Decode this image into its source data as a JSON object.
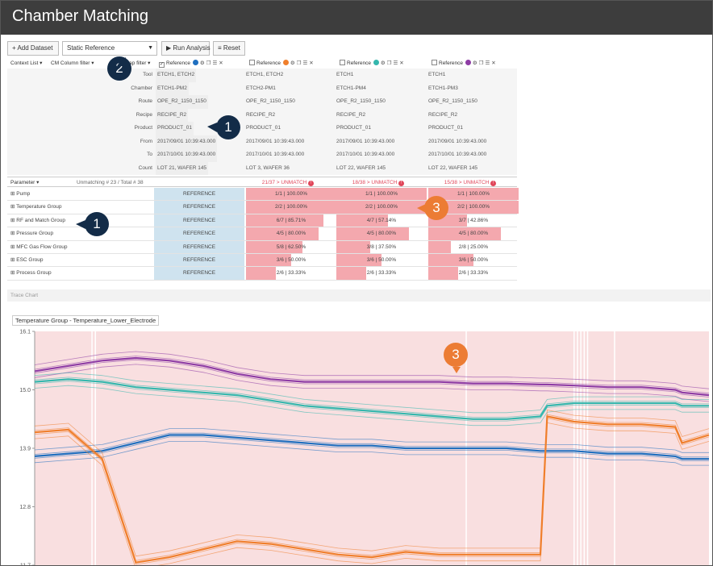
{
  "title": "Chamber Matching",
  "toolbar": {
    "add_dataset": "+ Add Dataset",
    "reference_select": "Static Reference",
    "run_analysis": "▶ Run Analysis",
    "reset": "Reset"
  },
  "header": {
    "context_list": "Context List ▾",
    "cm_column_filter": "CM Column filter ▾",
    "gap_filter": "Gap filter ▾",
    "columns": [
      {
        "label": "Reference",
        "checked": true,
        "color": "#1f6fbf"
      },
      {
        "label": "Reference",
        "checked": false,
        "color": "#f07f2c"
      },
      {
        "label": "Reference",
        "checked": false,
        "color": "#34b7ad"
      },
      {
        "label": "Reference",
        "checked": false,
        "color": "#8e3ca5"
      }
    ]
  },
  "meta": {
    "labels": [
      "Tool",
      "Chamber",
      "Route",
      "Recipe",
      "Product",
      "From",
      "To",
      "Count"
    ],
    "columns": [
      [
        "ETCH1, ETCH2",
        "ETCH1-PM2",
        "OPE_R2_1150_1150",
        "RECIPE_R2",
        "PRODUCT_01",
        "2017/09/01 10:39:43.000",
        "2017/10/01 10:39:43.000",
        "LOT 21, WAFER 145"
      ],
      [
        "ETCH1, ETCH2",
        "ETCH2-PM1",
        "OPE_R2_1150_1150",
        "RECIPE_R2",
        "PRODUCT_01",
        "2017/09/01 10:39:43.000",
        "2017/10/01 10:39:43.000",
        "LOT 3, WAFER 36"
      ],
      [
        "ETCH1",
        "ETCH1-PM4",
        "OPE_R2_1150_1150",
        "RECIPE_R2",
        "PRODUCT_01",
        "2017/09/01 10:39:43.000",
        "2017/10/01 10:39:43.000",
        "LOT 22, WAFER 145"
      ],
      [
        "ETCH1",
        "ETCH1-PM3",
        "OPE_R2_1150_1150",
        "RECIPE_R2",
        "PRODUCT_01",
        "2017/09/01 10:39:43.000",
        "2017/10/01 10:39:43.000",
        "LOT 22, WAFER 145"
      ]
    ]
  },
  "params": {
    "header_label": "Parameter ▾",
    "summary": "Unmatching # 23 / Total # 38",
    "unmatch": [
      "21/37 > UNMATCH",
      "18/38 > UNMATCH",
      "15/38 > UNMATCH"
    ],
    "rows": [
      {
        "name": "Pump",
        "ref": "REFERENCE",
        "cells": [
          {
            "text": "1/1 | 100.00%",
            "pct": 100
          },
          {
            "text": "1/1 | 100.00%",
            "pct": 100
          },
          {
            "text": "1/1 | 100.00%",
            "pct": 100
          }
        ]
      },
      {
        "name": "Temperature Group",
        "ref": "REFERENCE",
        "cells": [
          {
            "text": "2/2 | 100.00%",
            "pct": 100
          },
          {
            "text": "2/2 | 100.00%",
            "pct": 100
          },
          {
            "text": "2/2 | 100.00%",
            "pct": 100
          }
        ]
      },
      {
        "name": "RF and Match Group",
        "ref": "REFERENCE",
        "cells": [
          {
            "text": "6/7 | 85.71%",
            "pct": 85.71
          },
          {
            "text": "4/7 | 57.14%",
            "pct": 57.14
          },
          {
            "text": "3/7 | 42.86%",
            "pct": 42.86
          }
        ]
      },
      {
        "name": "Pressure Group",
        "ref": "REFERENCE",
        "cells": [
          {
            "text": "4/5 | 80.00%",
            "pct": 80
          },
          {
            "text": "4/5 | 80.00%",
            "pct": 80
          },
          {
            "text": "4/5 | 80.00%",
            "pct": 80
          }
        ]
      },
      {
        "name": "MFC Gas Flow Group",
        "ref": "REFERENCE",
        "cells": [
          {
            "text": "5/8 | 62.50%",
            "pct": 62.5
          },
          {
            "text": "3/8 | 37.50%",
            "pct": 37.5
          },
          {
            "text": "2/8 | 25.00%",
            "pct": 25
          }
        ]
      },
      {
        "name": "ESC Group",
        "ref": "REFERENCE",
        "cells": [
          {
            "text": "3/6 | 50.00%",
            "pct": 50
          },
          {
            "text": "3/6 | 50.00%",
            "pct": 50
          },
          {
            "text": "3/6 | 50.00%",
            "pct": 50
          }
        ]
      },
      {
        "name": "Process Group",
        "ref": "REFERENCE",
        "cells": [
          {
            "text": "2/6 | 33.33%",
            "pct": 33.33
          },
          {
            "text": "2/6 | 33.33%",
            "pct": 33.33
          },
          {
            "text": "2/6 | 33.33%",
            "pct": 33.33
          }
        ]
      }
    ]
  },
  "trace": {
    "section_label": "Trace Chart",
    "chart_title": "Temperature Group - Temperature_Lower_Electrode"
  },
  "badges": [
    "1",
    "1",
    "2",
    "3",
    "3"
  ],
  "chart_data": {
    "type": "line",
    "title": "Temperature Group - Temperature_Lower_Electrode",
    "ylim": [
      11.7,
      16.1
    ],
    "yticks": [
      16.1,
      15.0,
      13.9,
      12.8,
      11.7
    ],
    "x": [
      0,
      0.05,
      0.1,
      0.15,
      0.2,
      0.25,
      0.3,
      0.35,
      0.4,
      0.45,
      0.5,
      0.55,
      0.6,
      0.65,
      0.7,
      0.75,
      0.76,
      0.8,
      0.85,
      0.9,
      0.95,
      0.96,
      1.0
    ],
    "series": [
      {
        "name": "",
        "color": "#8e3ca5",
        "values": [
          15.35,
          15.45,
          15.55,
          15.6,
          15.55,
          15.45,
          15.3,
          15.2,
          15.15,
          15.15,
          15.15,
          15.15,
          15.15,
          15.12,
          15.12,
          15.1,
          15.1,
          15.08,
          15.05,
          15.05,
          15.0,
          14.95,
          14.9
        ]
      },
      {
        "name": "",
        "color": "#34b7ad",
        "values": [
          15.15,
          15.2,
          15.15,
          15.05,
          15.0,
          14.95,
          14.9,
          14.8,
          14.7,
          14.65,
          14.6,
          14.55,
          14.5,
          14.45,
          14.45,
          14.5,
          14.7,
          14.75,
          14.75,
          14.75,
          14.75,
          14.7,
          14.7
        ]
      },
      {
        "name": "",
        "color": "#1f6fbf",
        "values": [
          13.75,
          13.8,
          13.85,
          14.0,
          14.15,
          14.15,
          14.1,
          14.05,
          14.0,
          13.95,
          13.95,
          13.9,
          13.9,
          13.9,
          13.9,
          13.85,
          13.85,
          13.85,
          13.8,
          13.8,
          13.75,
          13.7,
          13.7
        ]
      },
      {
        "name": "",
        "color": "#f07f2c",
        "values": [
          14.2,
          14.25,
          13.7,
          11.75,
          11.85,
          12.0,
          12.15,
          12.1,
          12.0,
          11.9,
          11.85,
          11.95,
          11.9,
          11.9,
          11.9,
          11.9,
          14.5,
          14.4,
          14.35,
          14.35,
          14.3,
          14.0,
          14.15
        ]
      }
    ]
  }
}
